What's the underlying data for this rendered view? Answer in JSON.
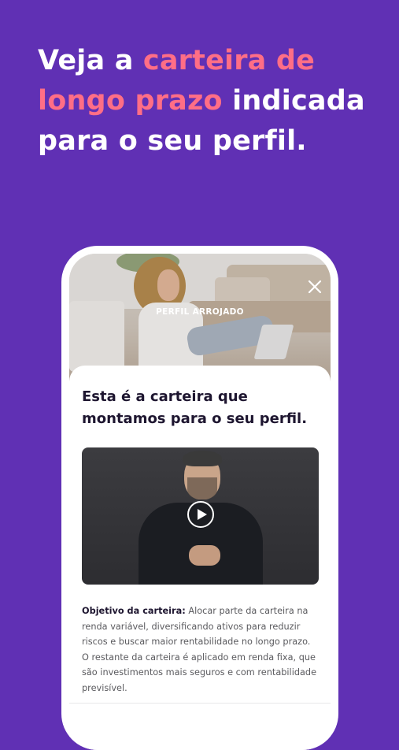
{
  "headline": {
    "part1": "Veja a ",
    "highlight": "carteira de longo prazo",
    "part2": " indicada para o seu perfil."
  },
  "hero": {
    "label": "PERFIL ARROJADO",
    "close_icon": "close-icon"
  },
  "card": {
    "title": "Esta é a carteira que montamos para o seu perfil.",
    "video_icon": "play-icon",
    "objective_label": "Objetivo da carteira:",
    "objective_text": " Alocar parte da carteira na renda variável, diversificando ativos para reduzir riscos e buscar maior rentabilidade no longo prazo. O restante da carteira é aplicado em renda fixa, que são investimentos mais seguros e com rentabilidade previsível."
  },
  "colors": {
    "background": "#6030b4",
    "accent": "#ff6e86",
    "title_text": "#1e1630"
  }
}
